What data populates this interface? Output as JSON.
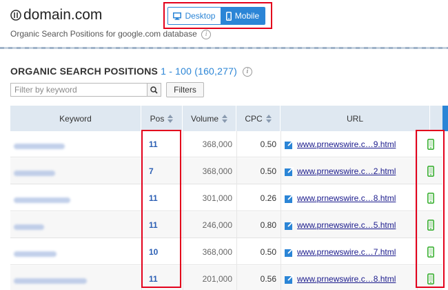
{
  "header": {
    "domain": "domain.com",
    "subtitle": "Organic Search Positions for google.com database",
    "info_glyph": "i"
  },
  "device_toggle": {
    "desktop_label": "Desktop",
    "mobile_label": "Mobile",
    "selected": "Mobile"
  },
  "section": {
    "title": "ORGANIC SEARCH POSITIONS",
    "range": "1 - 100 (160,277)"
  },
  "filter": {
    "placeholder": "Filter by keyword",
    "value": "",
    "filters_button": "Filters"
  },
  "table": {
    "columns": [
      "Keyword",
      "Pos",
      "Volume",
      "CPC",
      "URL"
    ],
    "rows": [
      {
        "keyword": "",
        "pos": "11",
        "volume": "368,000",
        "cpc": "0.50",
        "url": "www.prnewswire.c…9.html",
        "device": "mobile-icon"
      },
      {
        "keyword": "",
        "pos": "7",
        "volume": "368,000",
        "cpc": "0.50",
        "url": "www.prnewswire.c…2.html",
        "device": "mobile-icon"
      },
      {
        "keyword": "",
        "pos": "11",
        "volume": "301,000",
        "cpc": "0.26",
        "url": "www.prnewswire.c…8.html",
        "device": "mobile-icon"
      },
      {
        "keyword": "",
        "pos": "11",
        "volume": "246,000",
        "cpc": "0.80",
        "url": "www.prnewswire.c…5.html",
        "device": "mobile-icon"
      },
      {
        "keyword": "",
        "pos": "10",
        "volume": "368,000",
        "cpc": "0.50",
        "url": "www.prnewswire.c…7.html",
        "device": "mobile-icon"
      },
      {
        "keyword": "",
        "pos": "11",
        "volume": "201,000",
        "cpc": "0.56",
        "url": "www.prnewswire.c…8.html",
        "device": "mobile-icon"
      }
    ]
  },
  "colors": {
    "accent": "#2b85d6",
    "highlight": "#e3001b",
    "mobile_icon": "#3cb134",
    "header_bg": "#dfe8f1"
  }
}
